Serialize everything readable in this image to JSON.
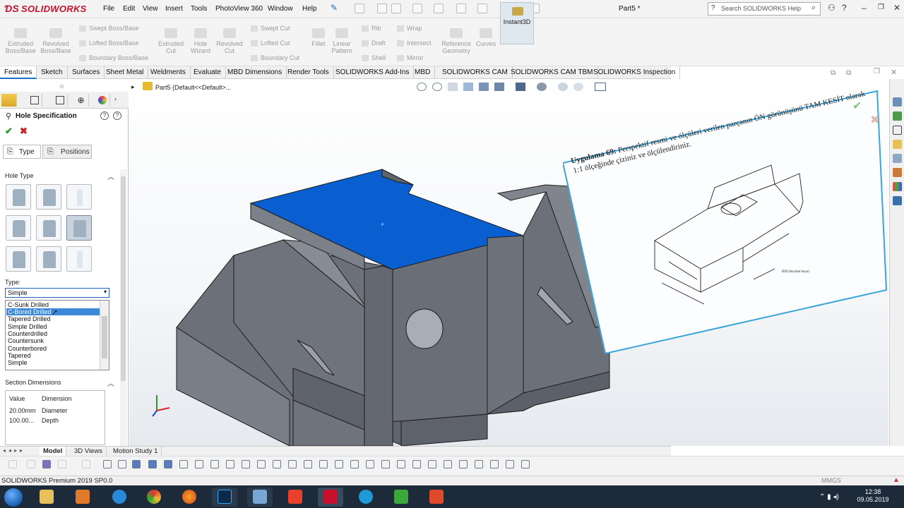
{
  "app": {
    "brand": "SOLIDWORKS",
    "doc_title": "Part5 *"
  },
  "menu": [
    "File",
    "Edit",
    "View",
    "Insert",
    "Tools",
    "PhotoView 360",
    "Window",
    "Help"
  ],
  "search": {
    "placeholder": "Search SOLIDWORKS Help"
  },
  "command_manager": {
    "large": [
      {
        "label": "Extruded Boss/Base"
      },
      {
        "label": "Revolved Boss/Base"
      },
      {
        "label": "Extruded Cut"
      },
      {
        "label": "Hole Wizard"
      },
      {
        "label": "Revolved Cut"
      },
      {
        "label": "Fillet"
      },
      {
        "label": "Linear Pattern"
      },
      {
        "label": "Reference Geometry"
      },
      {
        "label": "Curves"
      },
      {
        "label": "Instant3D"
      }
    ],
    "small": [
      "Swept Boss/Base",
      "Lofted Boss/Base",
      "Boundary Boss/Base",
      "Swept Cut",
      "Lofted Cut",
      "Boundary Cut",
      "Rib",
      "Draft",
      "Shell",
      "Wrap",
      "Intersect",
      "Mirror"
    ]
  },
  "tabs": [
    "Features",
    "Sketch",
    "Surfaces",
    "Sheet Metal",
    "Weldments",
    "Evaluate",
    "MBD Dimensions",
    "Render Tools",
    "SOLIDWORKS Add-Ins",
    "MBD",
    "SOLIDWORKS CAM",
    "SOLIDWORKS CAM TBM",
    "SOLIDWORKS Inspection"
  ],
  "breadcrumb": "Part5  (Default<<Default>...",
  "property_manager": {
    "title": "Hole Specification",
    "type_tab": "Type",
    "positions_tab": "Positions",
    "hole_type_header": "Hole Type",
    "type_label": "Type:",
    "type_value": "Simple",
    "type_options": [
      "C-Sunk Drilled",
      "C-Bored Drilled",
      "Tapered Drilled",
      "Simple Drilled",
      "Counterdrilled",
      "Countersunk",
      "Counterbored",
      "Tapered",
      "Simple"
    ],
    "highlighted_option": "C-Bored Drilled",
    "section_dimensions_header": "Section Dimensions",
    "dim_columns": [
      "Value",
      "Dimension"
    ],
    "dim_rows": [
      {
        "value": "20.00mm",
        "dimension": "Diameter"
      },
      {
        "value": "100.00...",
        "dimension": "Depth"
      }
    ]
  },
  "reference_image": {
    "heading_bold": "Uygulama 69:",
    "heading_text": "Perspektif resmi ve ölçüleri verilen parçanın ÖN görünüşünü TAM KESİT olarak 1:1 ölçeğinde çiziniz ve ölçülendiriniz."
  },
  "bottom_tabs": [
    "Model",
    "3D Views",
    "Motion Study 1"
  ],
  "status": {
    "text": "SOLIDWORKS Premium 2019 SP0.0",
    "units": "MMGS"
  },
  "clock": {
    "time": "12:38",
    "date": "09.05.2019"
  },
  "colors": {
    "selected_face": "#0a5fd0",
    "part_gray": "#6f737c",
    "brand_red": "#c8102e"
  }
}
